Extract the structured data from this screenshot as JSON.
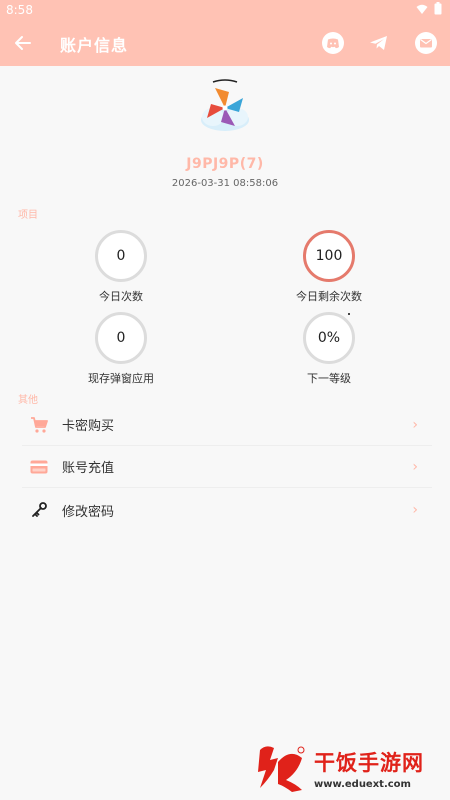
{
  "status_bar": {
    "time": "8:58"
  },
  "app_bar": {
    "title": "账户信息",
    "icons": [
      "back-arrow-icon",
      "discord-icon",
      "telegram-icon",
      "mail-icon"
    ]
  },
  "profile": {
    "username": "J9PJ9P(7)",
    "datetime": "2026-03-31 08:58:06"
  },
  "sections": {
    "items_label": "项目",
    "other_label": "其他"
  },
  "stats": [
    {
      "value": "0",
      "label": "今日次数",
      "accent": false
    },
    {
      "value": "100",
      "label": "今日剩余次数",
      "accent": true
    },
    {
      "value": "0",
      "label": "现存弹窗应用",
      "accent": false
    },
    {
      "value": "0%",
      "label": "下一等级",
      "accent": false
    }
  ],
  "menu": [
    {
      "label": "卡密购买",
      "icon": "cart-icon"
    },
    {
      "label": "账号充值",
      "icon": "credit-card-icon"
    },
    {
      "label": "修改密码",
      "icon": "key-icon"
    }
  ],
  "watermark": {
    "title": "干饭手游网",
    "url": "www.eduext.com"
  },
  "colors": {
    "primary": "#ffc2b4",
    "accent_text": "#ffb8a8",
    "ring_accent": "#e57a6c",
    "ring_default": "#dcdcdc",
    "watermark_red": "#e0221a"
  }
}
